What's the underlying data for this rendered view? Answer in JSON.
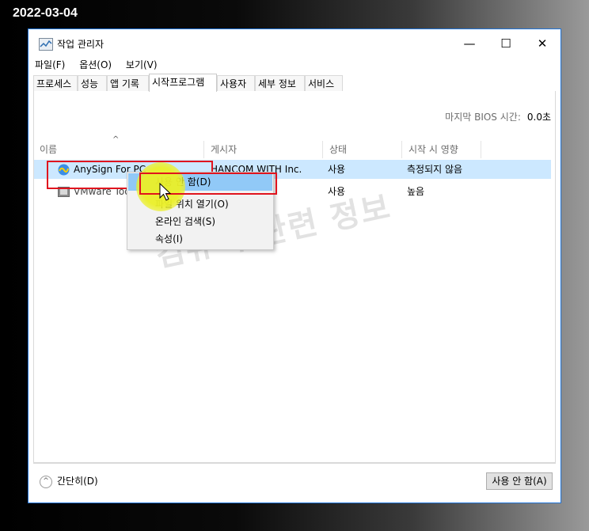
{
  "date_stamp": "2022-03-04",
  "window": {
    "title": "작업 관리자",
    "controls": {
      "minimize": "—",
      "maximize": "☐",
      "close": "✕"
    }
  },
  "menu": [
    "파일(F)",
    "옵션(O)",
    "보기(V)"
  ],
  "tabs": [
    "프로세스",
    "성능",
    "앱 기록",
    "시작프로그램",
    "사용자",
    "세부 정보",
    "서비스"
  ],
  "active_tab": "시작프로그램",
  "bios": {
    "label": "마지막 BIOS 시간:",
    "value": "0.0초"
  },
  "columns": [
    "이름",
    "게시자",
    "상태",
    "시작 시 영향"
  ],
  "rows": [
    {
      "name": "AnySign For PC",
      "publisher": "HANCOM WITH Inc.",
      "status": "사용",
      "impact": "측정되지 않음",
      "icon": "anysign-icon"
    },
    {
      "name": "VMware Too",
      "publisher": "",
      "status": "사용",
      "impact": "높음",
      "icon": "vmware-icon"
    }
  ],
  "context_menu": [
    "사용 안 함(D)",
    "파일 위치 열기(O)",
    "온라인 검색(S)",
    "속성(I)"
  ],
  "footer": {
    "fewer_details": "간단히(D)",
    "disable_button": "사용 안 함(A)"
  },
  "watermark": "컴퓨터 관련 정보",
  "colors": {
    "accent_border": "#1e73d8",
    "selection": "#cce8ff",
    "highlight_box": "#e0141e",
    "cursor_glow": "#ebf028"
  }
}
